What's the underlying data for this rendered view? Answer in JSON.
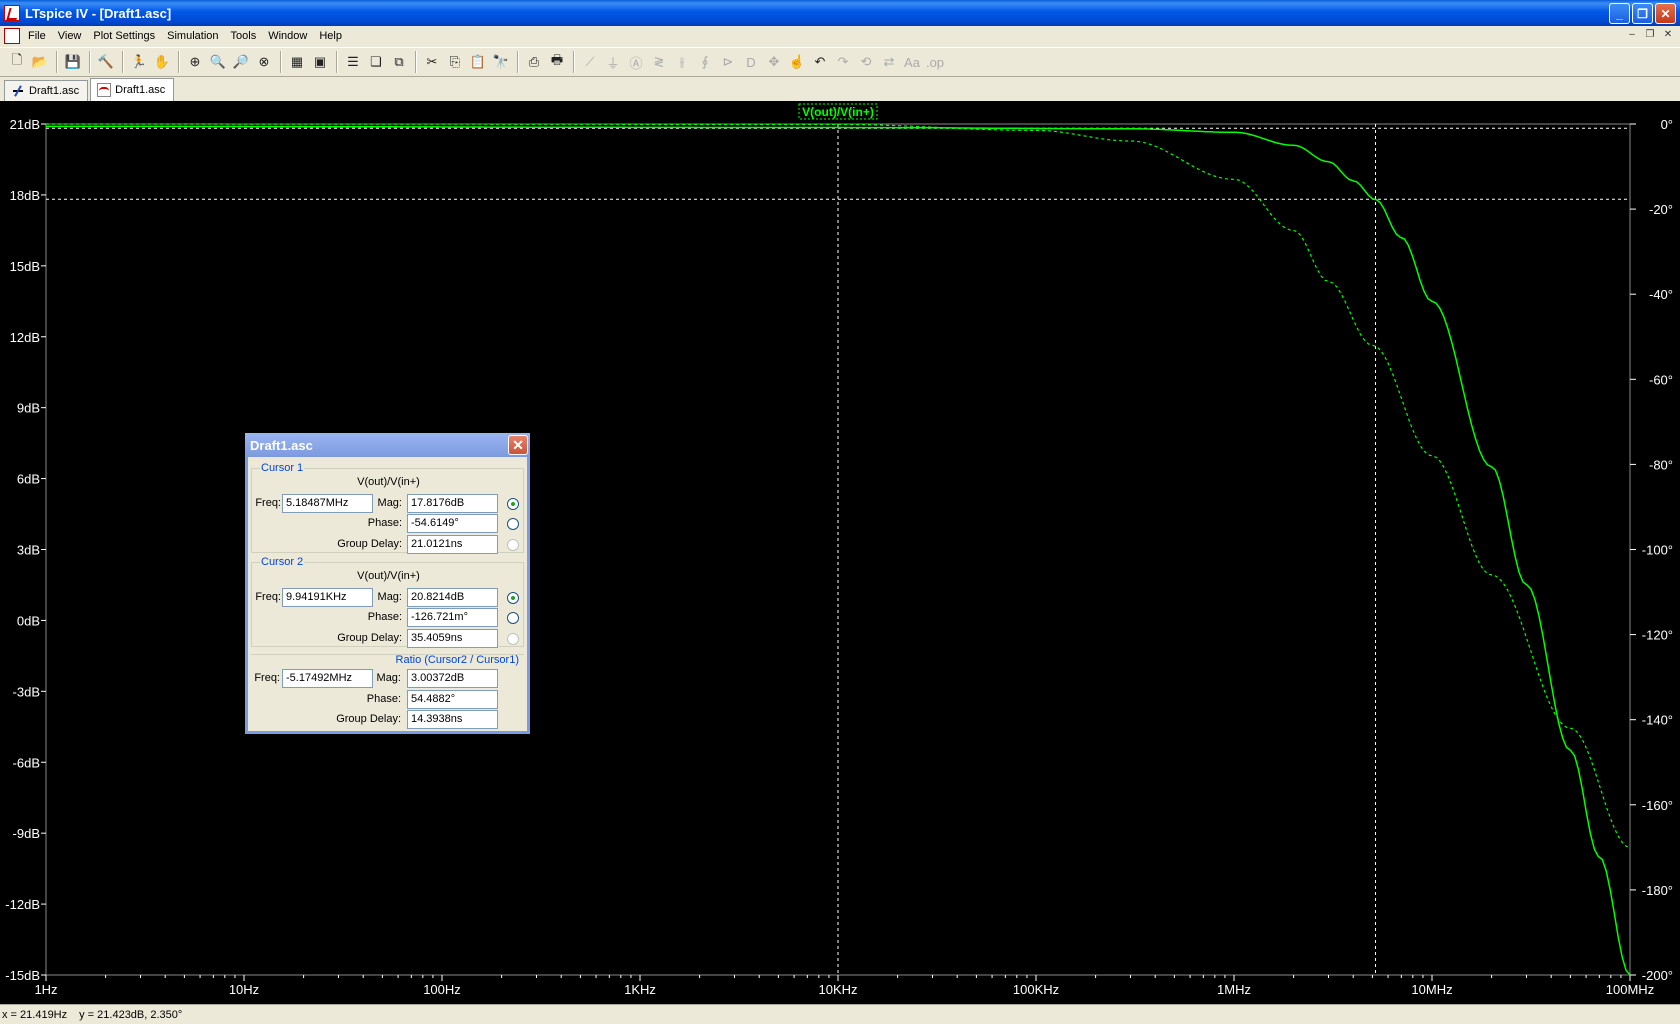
{
  "window": {
    "title": "LTspice IV - [Draft1.asc]",
    "buttons": [
      "_",
      "❐",
      "✕"
    ]
  },
  "menu": {
    "items": [
      "File",
      "View",
      "Plot Settings",
      "Simulation",
      "Tools",
      "Window",
      "Help"
    ],
    "mdi_buttons": [
      "–",
      "❐",
      "✕"
    ]
  },
  "toolbar": {
    "groups": [
      [
        {
          "name": "new-schematic-icon",
          "glyph": "🗋"
        },
        {
          "name": "open-icon",
          "glyph": "📂"
        }
      ],
      [
        {
          "name": "save-icon",
          "glyph": "💾"
        }
      ],
      [
        {
          "name": "control-panel-icon",
          "glyph": "🔨"
        }
      ],
      [
        {
          "name": "run-icon",
          "glyph": "🏃"
        },
        {
          "name": "halt-icon",
          "glyph": "✋",
          "disabled": true
        }
      ],
      [
        {
          "name": "zoom-area-icon",
          "glyph": "⊕"
        },
        {
          "name": "zoom-in-icon",
          "glyph": "🔍"
        },
        {
          "name": "zoom-out-icon",
          "glyph": "🔎"
        },
        {
          "name": "zoom-fit-icon",
          "glyph": "⊗"
        }
      ],
      [
        {
          "name": "autorange-icon",
          "glyph": "▦"
        },
        {
          "name": "mark-data-icon",
          "glyph": "▣"
        }
      ],
      [
        {
          "name": "tile-horizontal-icon",
          "glyph": "☰"
        },
        {
          "name": "cascade-icon",
          "glyph": "❏"
        },
        {
          "name": "tile-vertical-icon",
          "glyph": "⧉"
        }
      ],
      [
        {
          "name": "cut-icon",
          "glyph": "✂"
        },
        {
          "name": "copy-icon",
          "glyph": "⎘"
        },
        {
          "name": "paste-icon",
          "glyph": "📋",
          "disabled": true
        },
        {
          "name": "find-icon",
          "glyph": "🔭"
        }
      ],
      [
        {
          "name": "print-setup-icon",
          "glyph": "⎙"
        },
        {
          "name": "print-icon",
          "glyph": "🖶"
        }
      ],
      [
        {
          "name": "wire-icon",
          "glyph": "⟋",
          "disabled": true
        },
        {
          "name": "ground-icon",
          "glyph": "⏚",
          "disabled": true
        },
        {
          "name": "label-icon",
          "glyph": "Ⓐ",
          "disabled": true
        },
        {
          "name": "resistor-icon",
          "glyph": "≷",
          "disabled": true
        },
        {
          "name": "capacitor-icon",
          "glyph": "⫲",
          "disabled": true
        },
        {
          "name": "inductor-icon",
          "glyph": "∮",
          "disabled": true
        },
        {
          "name": "diode-icon",
          "glyph": "⊳",
          "disabled": true
        },
        {
          "name": "component-icon",
          "glyph": "D",
          "disabled": true
        },
        {
          "name": "move-icon",
          "glyph": "✥",
          "disabled": true
        },
        {
          "name": "drag-icon",
          "glyph": "☝",
          "disabled": true
        },
        {
          "name": "undo-icon",
          "glyph": "↶"
        },
        {
          "name": "redo-icon",
          "glyph": "↷",
          "disabled": true
        },
        {
          "name": "rotate-icon",
          "glyph": "⟲",
          "disabled": true
        },
        {
          "name": "mirror-icon",
          "glyph": "⇄",
          "disabled": true
        },
        {
          "name": "text-icon",
          "glyph": "Aa",
          "disabled": true
        },
        {
          "name": "spice-directive-icon",
          "glyph": ".op",
          "disabled": true
        }
      ]
    ]
  },
  "tabs": [
    {
      "label": "Draft1.asc",
      "kind": "schematic"
    },
    {
      "label": "Draft1.asc",
      "kind": "waveform",
      "active": true
    }
  ],
  "plot": {
    "trace_label": "V(out)/V(in+)",
    "bg_color": "#000000",
    "trace_color": "#00ff00",
    "grid_color": "#ffffff"
  },
  "chart_data": {
    "type": "line",
    "title": "",
    "x_scale": "log",
    "xlim": [
      1,
      100000000
    ],
    "x_ticks": [
      {
        "v": 1,
        "label": "1Hz"
      },
      {
        "v": 10,
        "label": "10Hz"
      },
      {
        "v": 100,
        "label": "100Hz"
      },
      {
        "v": 1000,
        "label": "1KHz"
      },
      {
        "v": 10000,
        "label": "10KHz"
      },
      {
        "v": 100000,
        "label": "100KHz"
      },
      {
        "v": 1000000,
        "label": "1MHz"
      },
      {
        "v": 10000000,
        "label": "10MHz"
      },
      {
        "v": 100000000,
        "label": "100MHz"
      }
    ],
    "y_left": {
      "lim": [
        -15,
        21
      ],
      "ticks": [
        {
          "v": 21,
          "label": "21dB"
        },
        {
          "v": 18,
          "label": "18dB"
        },
        {
          "v": 15,
          "label": "15dB"
        },
        {
          "v": 12,
          "label": "12dB"
        },
        {
          "v": 9,
          "label": "9dB"
        },
        {
          "v": 6,
          "label": "6dB"
        },
        {
          "v": 3,
          "label": "3dB"
        },
        {
          "v": 0,
          "label": "0dB"
        },
        {
          "v": -3,
          "label": "-3dB"
        },
        {
          "v": -6,
          "label": "-6dB"
        },
        {
          "v": -9,
          "label": "-9dB"
        },
        {
          "v": -12,
          "label": "-12dB"
        },
        {
          "v": -15,
          "label": "-15dB"
        }
      ]
    },
    "y_right": {
      "lim": [
        -200,
        0
      ],
      "ticks": [
        {
          "v": 0,
          "label": "0°"
        },
        {
          "v": -20,
          "label": "-20°"
        },
        {
          "v": -40,
          "label": "-40°"
        },
        {
          "v": -60,
          "label": "-60°"
        },
        {
          "v": -80,
          "label": "-80°"
        },
        {
          "v": -100,
          "label": "-100°"
        },
        {
          "v": -120,
          "label": "-120°"
        },
        {
          "v": -140,
          "label": "-140°"
        },
        {
          "v": -160,
          "label": "-160°"
        },
        {
          "v": -180,
          "label": "-180°"
        },
        {
          "v": -200,
          "label": "-200°"
        }
      ]
    },
    "series": [
      {
        "style": "solid",
        "axis": "left",
        "x": [
          1,
          10000,
          300000,
          1000000,
          2000000,
          3000000,
          4000000,
          5185000,
          7000000,
          10000000,
          20000000,
          30000000,
          50000000,
          70000000,
          100000000
        ],
        "values": [
          20.9,
          20.85,
          20.8,
          20.65,
          20.1,
          19.4,
          18.6,
          17.8,
          16.2,
          13.5,
          6.5,
          1.5,
          -5.5,
          -10,
          -15
        ]
      },
      {
        "style": "dashed",
        "axis": "right",
        "x": [
          1,
          10000,
          100000,
          300000,
          1000000,
          2000000,
          3000000,
          5000000,
          10000000,
          20000000,
          50000000,
          100000000
        ],
        "values": [
          0,
          -0.1,
          -1.5,
          -4,
          -13,
          -25,
          -37,
          -52,
          -78,
          -106,
          -142,
          -170
        ]
      }
    ],
    "cursors": [
      {
        "x": 10000,
        "value": 20.8214
      },
      {
        "x": 5185000,
        "value": 17.8176
      }
    ]
  },
  "cursor_panel": {
    "title": "Draft1.asc",
    "cursor1": {
      "label": "Cursor 1",
      "expr": "V(out)/V(in+)",
      "freq_label": "Freq:",
      "freq": "5.18487MHz",
      "mag_label": "Mag:",
      "mag": "17.8176dB",
      "phase_label": "Phase:",
      "phase": "-54.6149°",
      "gd_label": "Group Delay:",
      "gd": "21.0121ns"
    },
    "cursor2": {
      "label": "Cursor 2",
      "expr": "V(out)/V(in+)",
      "freq_label": "Freq:",
      "freq": "9.94191KHz",
      "mag_label": "Mag:",
      "mag": "20.8214dB",
      "phase_label": "Phase:",
      "phase": "-126.721m°",
      "gd_label": "Group Delay:",
      "gd": "35.4059ns"
    },
    "ratio": {
      "label": "Ratio (Cursor2 / Cursor1)",
      "freq_label": "Freq:",
      "freq": "-5.17492MHz",
      "mag_label": "Mag:",
      "mag": "3.00372dB",
      "phase_label": "Phase:",
      "phase": "54.4882°",
      "gd_label": "Group Delay:",
      "gd": "14.3938ns"
    }
  },
  "status": {
    "x": "x = 21.419Hz",
    "y": "y = 21.423dB, 2.350°"
  }
}
